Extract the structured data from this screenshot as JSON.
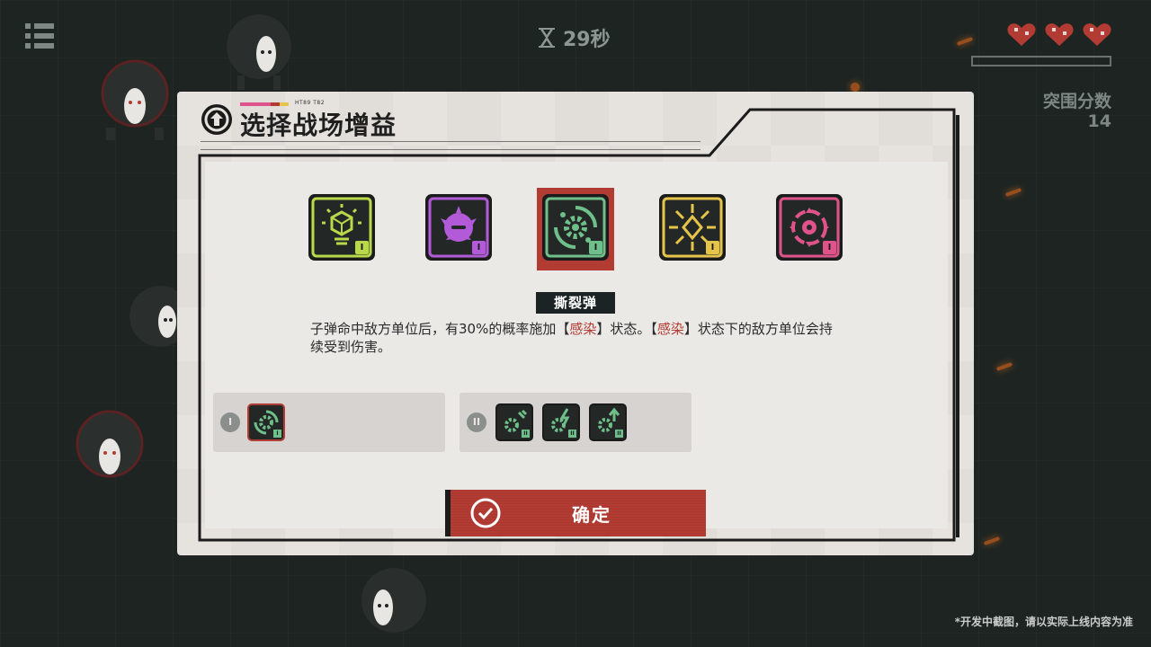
{
  "hud": {
    "timer": "29秒",
    "hearts": 3,
    "score_label": "突围分数",
    "score_value": "14"
  },
  "modal": {
    "title": "选择战场增益",
    "title_small": "HT89 T82",
    "confirm_label": "确定"
  },
  "buffs": [
    {
      "name": "buff-1",
      "icon": "hexagon-light-icon",
      "color": "#b9d84a",
      "level": "I",
      "selected": false
    },
    {
      "name": "buff-2",
      "icon": "spiky-blob-icon",
      "color": "#b25ad8",
      "level": "I",
      "selected": false
    },
    {
      "name": "buff-3",
      "icon": "gear-burst-icon",
      "color": "#6fbf8a",
      "level": "I",
      "selected": true
    },
    {
      "name": "buff-4",
      "icon": "sun-diamond-icon",
      "color": "#e6c44a",
      "level": "I",
      "selected": false
    },
    {
      "name": "buff-5",
      "icon": "target-ring-icon",
      "color": "#e0538a",
      "level": "I",
      "selected": false
    }
  ],
  "selected_buff": {
    "name": "撕裂弹",
    "desc_parts": [
      {
        "text": "子弹命中敌方单位后，有30%的概率施加【",
        "hl": false
      },
      {
        "text": "感染",
        "hl": true
      },
      {
        "text": "】状态。【",
        "hl": false
      },
      {
        "text": "感染",
        "hl": true
      },
      {
        "text": "】状态下的敌方单位会持续受到伤害。",
        "hl": false
      }
    ]
  },
  "tiers": {
    "tier1_label": "I",
    "tier2_label": "II",
    "tier1_badge": "I",
    "tier2_badge": "II"
  },
  "disclaimer": "*开发中截图，请以实际上线内容为准",
  "colors": {
    "accent_red": "#b23b33",
    "panel": "#e6e3df",
    "dark": "#1b2324"
  }
}
